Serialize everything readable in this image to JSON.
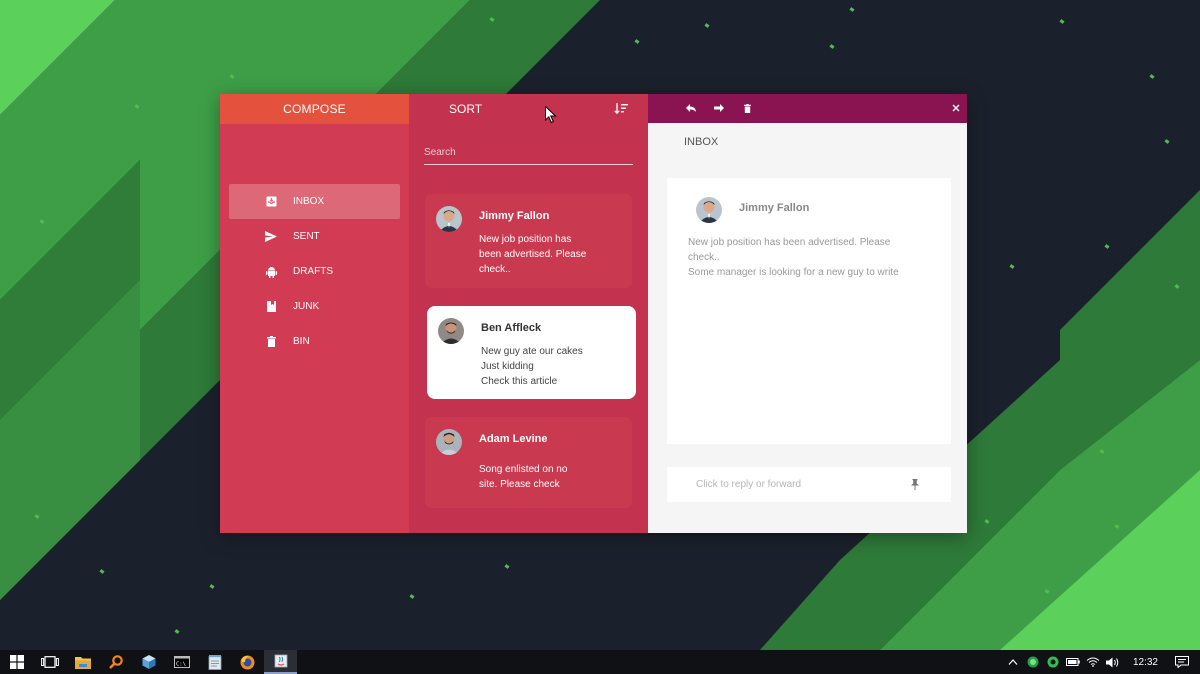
{
  "sidebar": {
    "compose_label": "COMPOSE",
    "items": [
      {
        "label": "INBOX",
        "icon": "inbox-icon",
        "active": true
      },
      {
        "label": "SENT",
        "icon": "send-icon"
      },
      {
        "label": "DRAFTS",
        "icon": "android-icon"
      },
      {
        "label": "JUNK",
        "icon": "bookmark-icon"
      },
      {
        "label": "BIN",
        "icon": "trash-icon"
      }
    ]
  },
  "list": {
    "sort_label": "SORT",
    "sort_icon": "sort-icon",
    "search_placeholder": "Search",
    "messages": [
      {
        "name": "Jimmy Fallon",
        "lines": [
          "New job position has",
          "been advertised. Please",
          "check.."
        ]
      },
      {
        "name": "Ben Affleck",
        "lines": [
          "New guy ate our cakes",
          "Just kidding",
          "Check this article"
        ],
        "selected": true
      },
      {
        "name": "Adam Levine",
        "lines": [
          "Song enlisted on no",
          "site. Please check"
        ]
      }
    ]
  },
  "reader": {
    "toolbar_icons": [
      "reply-icon",
      "forward-icon",
      "delete-icon",
      "close-icon"
    ],
    "title": "INBOX",
    "message": {
      "name": "Jimmy Fallon",
      "lines": [
        "New job position has been advertised. Please",
        "check..",
        "Some manager is looking for a new guy to write"
      ]
    },
    "reply_placeholder": "Click to reply or forward",
    "pin_icon": "pin-icon"
  },
  "taskbar": {
    "time": "12:32",
    "apps": [
      "windows-start-icon",
      "task-view-icon",
      "file-explorer-icon",
      "search-app-icon",
      "cube-app-icon",
      "terminal-icon",
      "notepad-icon",
      "firefox-icon",
      "java-app-icon"
    ],
    "tray": [
      "chevron-up-icon",
      "green-dot-icon",
      "green-circle-icon",
      "battery-icon",
      "wifi-icon",
      "volume-icon",
      "notification-icon"
    ]
  },
  "colors": {
    "compose": "#e4513d",
    "sidebar": "#d13c54",
    "list": "#c3324e",
    "reader_bar": "#8a1452",
    "reader_bg": "#f5f5f5",
    "desktop_green": "#4caf50",
    "desktop_dark": "#1b212c"
  }
}
